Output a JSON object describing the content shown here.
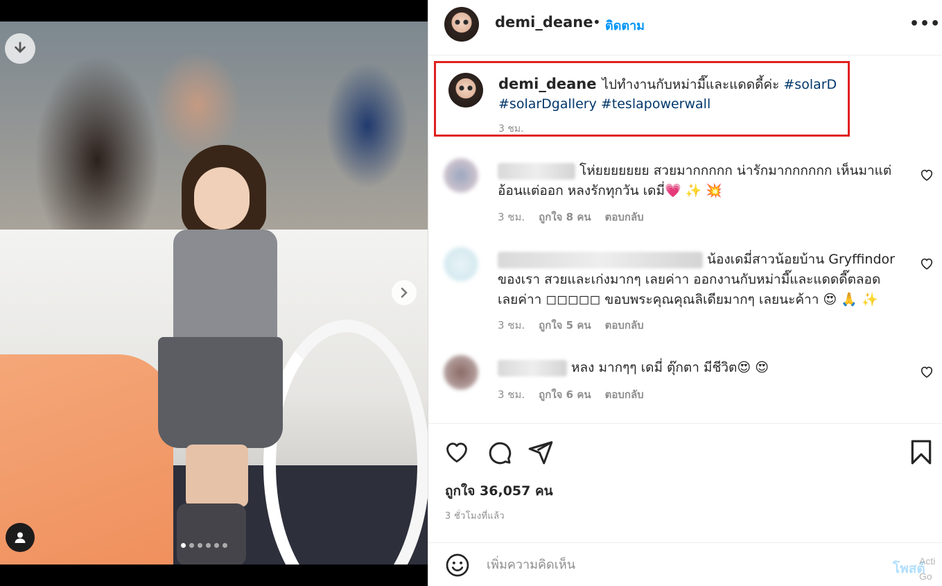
{
  "post": {
    "username": "demi_deane",
    "follow_label": "ติดตาม",
    "separator": "•",
    "more_label": "•••"
  },
  "caption": {
    "username": "demi_deane",
    "text": "ไปทำงานกับหม่ามี๊และแดดดี้ค่ะ",
    "hashtags": [
      "#solarD",
      "#solarDgallery",
      "#teslapowerwall"
    ],
    "time": "3 ชม."
  },
  "comments": [
    {
      "text": "โห่ยยยยยยย สวยมากกกกก น่ารักมากกกกกก เห็นมาแต่อ้อนแต่ออก หลงรักทุกวัน เดมี่💗 ✨ 💥",
      "time": "3 ชม.",
      "likes": "ถูกใจ 8 คน",
      "reply": "ตอบกลับ"
    },
    {
      "text": "น้องเดมี่สาวน้อยบ้าน Gryffindor ของเรา สวยและเก่งมากๆ เลยค่าา ออกงานกับหม่ามี๊และแดดดี๊ตลอดเลยค่าา ◻◻◻◻◻ ขอบพระคุณคุณลิเดียมากๆ เลยนะค้าา 😍 🙏 ✨",
      "time": "3 ชม.",
      "likes": "ถูกใจ 5 คน",
      "reply": "ตอบกลับ"
    },
    {
      "text": "หลง มากๆๆ เดมี่ ตุ๊กตา มีชีวิต😍 😍",
      "time": "3 ชม.",
      "likes": "ถูกใจ 6 คน",
      "reply": "ตอบกลับ"
    }
  ],
  "engagement": {
    "likes": "ถูกใจ 36,057 คน",
    "posted_ago": "3 ชั่วโมงที่แล้ว"
  },
  "comment_bar": {
    "placeholder": "เพิ่มความคิดเห็น",
    "post_label": "โพสต์"
  },
  "watermark": {
    "line1": "Acti",
    "line2": "Go to"
  },
  "carousel": {
    "slide_count": 6,
    "active_index": 0
  },
  "colors": {
    "link": "#0095f6",
    "hashtag": "#00376b",
    "highlight_border": "#e02020",
    "muted": "#8e8e8e"
  },
  "icons": [
    "download-icon",
    "chevron-right-icon",
    "user-tag-icon",
    "heart-icon",
    "comment-icon",
    "share-icon",
    "bookmark-icon",
    "emoji-icon",
    "more-icon"
  ]
}
